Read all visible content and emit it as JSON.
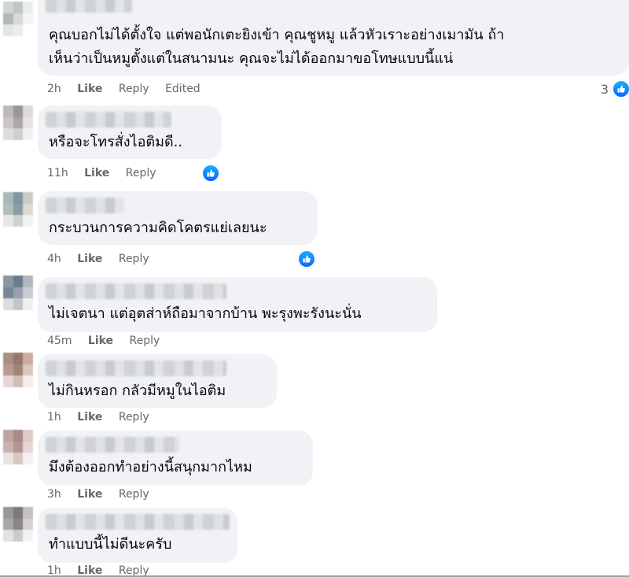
{
  "actions": {
    "like": "Like",
    "reply": "Reply"
  },
  "comments": [
    {
      "text_lines": [
        "คุณบอกไม่ได้ตั้งใจ แต่พอนักเตะยิงเข้า คุณชูหมู แล้วหัวเราะอย่างเมามัน ถ้า",
        "เห็นว่าเป็นหมูตั้งแต่ในสนามนะ คุณจะไม่ได้ออกมาขอโทษแบบนี้แน่"
      ],
      "time": "2h",
      "edited": "Edited",
      "reaction_count": "3",
      "reaction_icon": "thumbs-up-icon",
      "avatar_colors": [
        "#c9d3cf",
        "#b8c2bf",
        "#e8eceb",
        "#a9b2ae",
        "#cfd6d3",
        "#f1f3f2",
        "#dfe4e2",
        "#e9ecea",
        "#ffffff"
      ]
    },
    {
      "text_lines": [
        "หรือจะโทรสั่งไอติมดี.."
      ],
      "time": "11h",
      "reaction_icon": "thumbs-up-icon",
      "avatar_colors": [
        "#b9b1b3",
        "#8f8c8f",
        "#d9d7d8",
        "#c4c0c2",
        "#a39ea1",
        "#e4e1e2",
        "#dcd9da",
        "#cfcacc",
        "#f1efef"
      ]
    },
    {
      "text_lines": [
        "กระบวนการความคิดโคตรแย่เลยนะ"
      ],
      "time": "4h",
      "reaction_icon": "thumbs-up-icon",
      "avatar_colors": [
        "#9fb3b0",
        "#6f8d95",
        "#c9c5c0",
        "#a9b7b5",
        "#7d9399",
        "#d8d6d1",
        "#e3e6e5",
        "#c7cfce",
        "#f0f1f0"
      ]
    },
    {
      "text_lines": [
        "ไม่เจตนา แต่อุตส่าห์ถือมาจากบ้าน พะรุงพะรังนะนั่น"
      ],
      "time": "45m",
      "avatar_colors": [
        "#7f8a9a",
        "#5c6d80",
        "#a8b0ba",
        "#6c7a8c",
        "#8b96a6",
        "#c2c8cf",
        "#d5d9de",
        "#b8bfc8",
        "#eceef0"
      ]
    },
    {
      "text_lines": [
        "ไม่กินหรอก กลัวมีหมูในไอติม"
      ],
      "time": "1h",
      "avatar_colors": [
        "#a08578",
        "#8b6a5e",
        "#c7a59c",
        "#b38f84",
        "#9a7669",
        "#d8c0b8",
        "#e2d4cf",
        "#cdb7af",
        "#f3ece9"
      ]
    },
    {
      "text_lines": [
        "มึงต้องออกทำอย่างนี้สนุกมากไหม"
      ],
      "time": "3h",
      "avatar_colors": [
        "#b79a96",
        "#9d7f7b",
        "#dcc6c2",
        "#c7aaa5",
        "#a88b87",
        "#e4d3d0",
        "#eadfdd",
        "#d6c1be",
        "#f5efee"
      ]
    },
    {
      "text_lines": [
        "ทำแบบนี้ไม่ดีนะครับ"
      ],
      "time": "1h",
      "avatar_colors": [
        "#8f8c8c",
        "#6f6b6b",
        "#bdbaba",
        "#a19e9e",
        "#7f7b7b",
        "#d0cdcd",
        "#e0dede",
        "#c9c6c6",
        "#f2f1f1"
      ]
    }
  ]
}
